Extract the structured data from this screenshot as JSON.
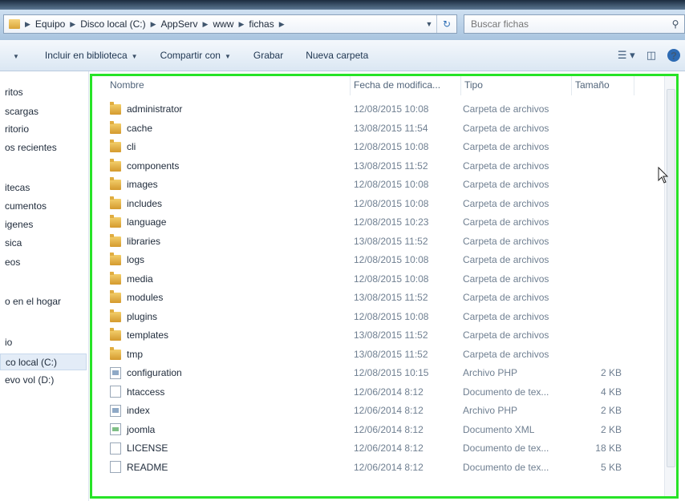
{
  "address_bar": {
    "crumbs": [
      "Equipo",
      "Disco local (C:)",
      "AppServ",
      "www",
      "fichas"
    ]
  },
  "search": {
    "placeholder": "Buscar fichas"
  },
  "toolbar": {
    "include_library": "Incluir en biblioteca",
    "share_with": "Compartir con",
    "burn": "Grabar",
    "new_folder": "Nueva carpeta"
  },
  "nav": {
    "items": [
      "ritos",
      "scargas",
      "ritorio",
      "os recientes",
      "itecas",
      "cumentos",
      "igenes",
      "sica",
      "eos",
      "o en el hogar",
      "io",
      "co local (C:)",
      "evo vol (D:)"
    ]
  },
  "columns": {
    "name": "Nombre",
    "date": "Fecha de modifica...",
    "type": "Tipo",
    "size": "Tamaño"
  },
  "files": [
    {
      "name": "administrator",
      "date": "12/08/2015 10:08",
      "type": "Carpeta de archivos",
      "size": "",
      "icon": "folder"
    },
    {
      "name": "cache",
      "date": "13/08/2015 11:54",
      "type": "Carpeta de archivos",
      "size": "",
      "icon": "folder"
    },
    {
      "name": "cli",
      "date": "12/08/2015 10:08",
      "type": "Carpeta de archivos",
      "size": "",
      "icon": "folder"
    },
    {
      "name": "components",
      "date": "13/08/2015 11:52",
      "type": "Carpeta de archivos",
      "size": "",
      "icon": "folder"
    },
    {
      "name": "images",
      "date": "12/08/2015 10:08",
      "type": "Carpeta de archivos",
      "size": "",
      "icon": "folder"
    },
    {
      "name": "includes",
      "date": "12/08/2015 10:08",
      "type": "Carpeta de archivos",
      "size": "",
      "icon": "folder"
    },
    {
      "name": "language",
      "date": "12/08/2015 10:23",
      "type": "Carpeta de archivos",
      "size": "",
      "icon": "folder"
    },
    {
      "name": "libraries",
      "date": "13/08/2015 11:52",
      "type": "Carpeta de archivos",
      "size": "",
      "icon": "folder"
    },
    {
      "name": "logs",
      "date": "12/08/2015 10:08",
      "type": "Carpeta de archivos",
      "size": "",
      "icon": "folder"
    },
    {
      "name": "media",
      "date": "12/08/2015 10:08",
      "type": "Carpeta de archivos",
      "size": "",
      "icon": "folder"
    },
    {
      "name": "modules",
      "date": "13/08/2015 11:52",
      "type": "Carpeta de archivos",
      "size": "",
      "icon": "folder"
    },
    {
      "name": "plugins",
      "date": "12/08/2015 10:08",
      "type": "Carpeta de archivos",
      "size": "",
      "icon": "folder"
    },
    {
      "name": "templates",
      "date": "13/08/2015 11:52",
      "type": "Carpeta de archivos",
      "size": "",
      "icon": "folder"
    },
    {
      "name": "tmp",
      "date": "13/08/2015 11:52",
      "type": "Carpeta de archivos",
      "size": "",
      "icon": "folder"
    },
    {
      "name": "configuration",
      "date": "12/08/2015 10:15",
      "type": "Archivo PHP",
      "size": "2 KB",
      "icon": "php"
    },
    {
      "name": "htaccess",
      "date": "12/06/2014 8:12",
      "type": "Documento de tex...",
      "size": "4 KB",
      "icon": "doc"
    },
    {
      "name": "index",
      "date": "12/06/2014 8:12",
      "type": "Archivo PHP",
      "size": "2 KB",
      "icon": "php"
    },
    {
      "name": "joomla",
      "date": "12/06/2014 8:12",
      "type": "Documento XML",
      "size": "2 KB",
      "icon": "xml"
    },
    {
      "name": "LICENSE",
      "date": "12/06/2014 8:12",
      "type": "Documento de tex...",
      "size": "18 KB",
      "icon": "doc"
    },
    {
      "name": "README",
      "date": "12/06/2014 8:12",
      "type": "Documento de tex...",
      "size": "5 KB",
      "icon": "doc"
    }
  ],
  "colors": {
    "highlight_border": "#27e327",
    "nav_selected": "#e3ecf7"
  }
}
